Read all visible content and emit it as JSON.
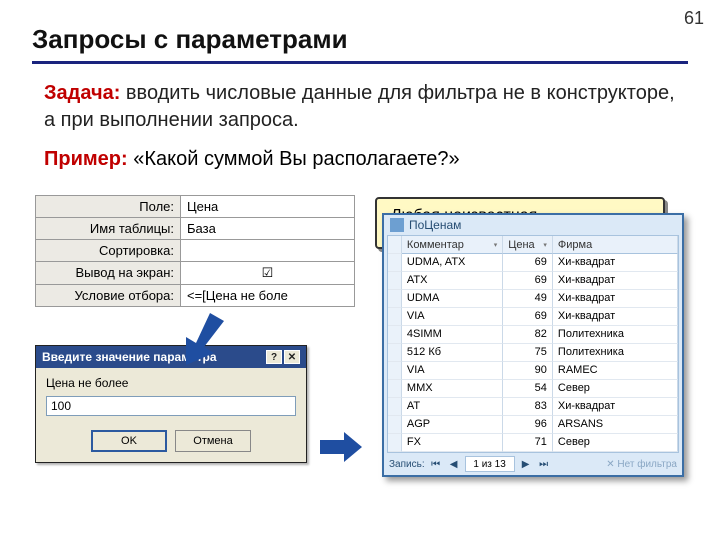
{
  "page_number": "61",
  "title": "Запросы с параметрами",
  "task_label": "Задача:",
  "task_text": " вводить числовые данные для фильтра не в конструкторе, а при выполнении запроса.",
  "example_label": "Пример:",
  "example_text": " «Какой суммой Вы располагаете?»",
  "design": {
    "rows": [
      {
        "label": "Поле:",
        "value": "Цена"
      },
      {
        "label": "Имя таблицы:",
        "value": "База"
      },
      {
        "label": "Сортировка:",
        "value": ""
      },
      {
        "label": "Вывод на экран:",
        "value": "☑"
      },
      {
        "label": "Условие отбора:",
        "value": "<=[Цена не боле"
      }
    ]
  },
  "note_line1": "Любая неизвестная",
  "dialog": {
    "title": "Введите значение параметра",
    "label": "Цена не более",
    "value": "100",
    "ok": "OK",
    "cancel": "Отмена"
  },
  "sheet": {
    "title": "ПоЦенам",
    "columns": [
      "Комментар",
      "Цена",
      "Фирма"
    ],
    "rows": [
      [
        "UDMA, ATX",
        "69",
        "Хи-квадрат"
      ],
      [
        "ATX",
        "69",
        "Хи-квадрат"
      ],
      [
        "UDMA",
        "49",
        "Хи-квадрат"
      ],
      [
        "VIA",
        "69",
        "Хи-квадрат"
      ],
      [
        "4SIMM",
        "82",
        "Политехника"
      ],
      [
        "512 Кб",
        "75",
        "Политехника"
      ],
      [
        "VIA",
        "90",
        "RAMEC"
      ],
      [
        "MMX",
        "54",
        "Север"
      ],
      [
        "AT",
        "83",
        "Хи-квадрат"
      ],
      [
        "AGP",
        "96",
        "ARSANS"
      ],
      [
        "FX",
        "71",
        "Север"
      ]
    ],
    "nav_label": "Запись:",
    "nav_pos": "1 из 13",
    "no_filter": "Нет фильтра"
  }
}
